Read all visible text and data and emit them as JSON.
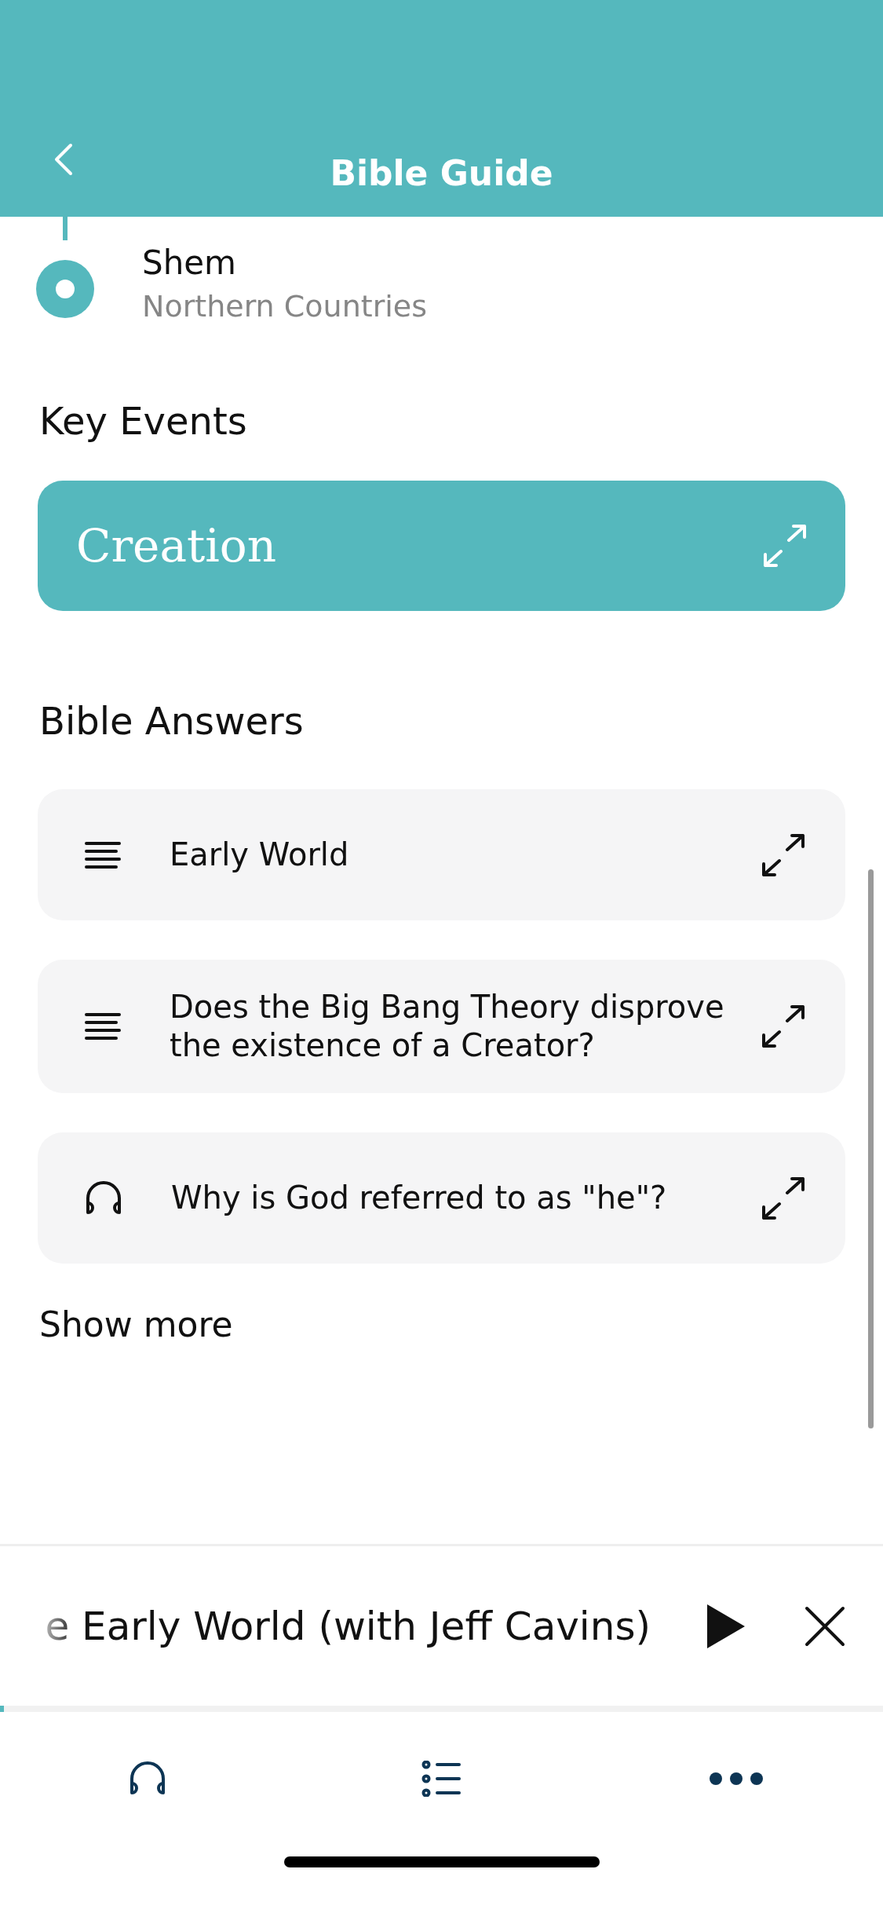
{
  "header": {
    "title": "Bible Guide"
  },
  "timeline": {
    "name": "Shem",
    "subtitle": "Northern Countries"
  },
  "key_events": {
    "heading": "Key Events",
    "items": [
      {
        "title": "Creation"
      }
    ]
  },
  "bible_answers": {
    "heading": "Bible Answers",
    "items": [
      {
        "kind": "article",
        "title": "Early World"
      },
      {
        "kind": "article",
        "title": "Does the Big Bang Theory disprove the existence of a Creator?"
      },
      {
        "kind": "audio",
        "title": "Why is God referred to as \"he\"?"
      }
    ],
    "show_more": "Show more"
  },
  "mini_player": {
    "title": "e Early World (with Jeff Cavins)",
    "level": 0.004
  },
  "tab_bar": {
    "items": [
      {
        "kind": "listen"
      },
      {
        "kind": "guide"
      },
      {
        "kind": "more"
      }
    ]
  }
}
